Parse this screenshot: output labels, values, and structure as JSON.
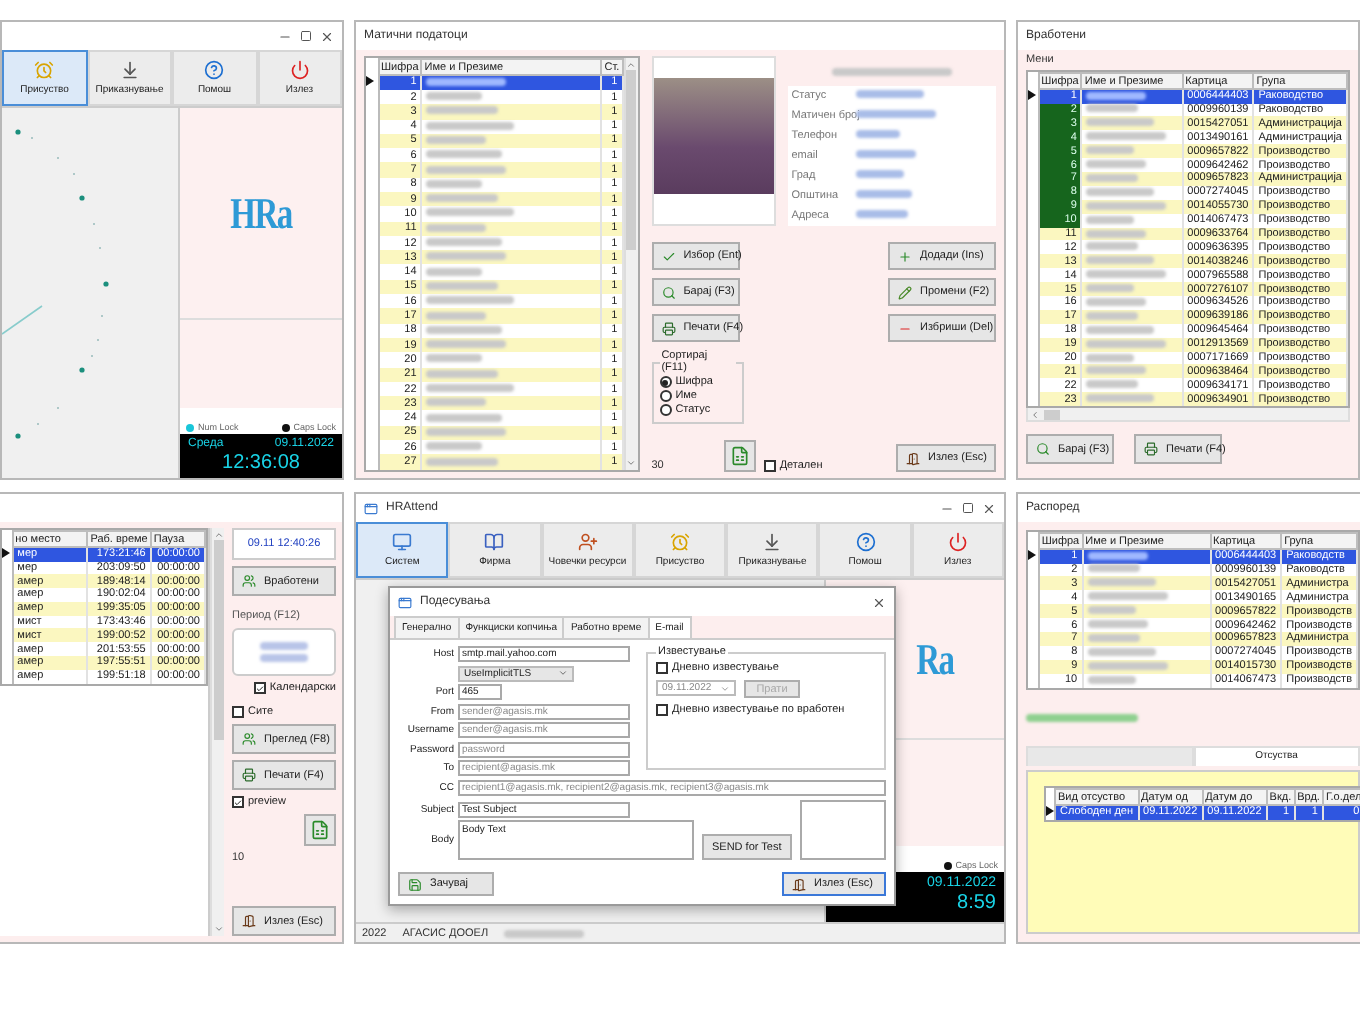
{
  "attendance_window": {
    "toolbar": [
      {
        "label": "Присуство",
        "selected": true
      },
      {
        "label": "Приказнување",
        "selected": false
      },
      {
        "label": "Помош",
        "selected": false
      },
      {
        "label": "Излез",
        "selected": false
      }
    ],
    "logo": "HRa",
    "indicators": [
      {
        "label": "Num Lock",
        "on": true
      },
      {
        "label": "Caps Lock",
        "on": false
      }
    ],
    "day": "Среда",
    "date": "09.11.2022",
    "time": "12:36:08"
  },
  "master_data": {
    "title": "Матични податоци",
    "table": {
      "columns": [
        {
          "label": "Шифра"
        },
        {
          "label": "Ст."
        }
      ],
      "name_column": "Име и Презиме",
      "rows": [
        {
          "cells": [
            "1",
            "1"
          ],
          "selected": true
        },
        {
          "cells": [
            "2",
            "1"
          ],
          "selected": false
        },
        {
          "cells": [
            "3",
            "1"
          ],
          "selected": false
        },
        {
          "cells": [
            "4",
            "1"
          ],
          "selected": false
        },
        {
          "cells": [
            "5",
            "1"
          ],
          "selected": false
        },
        {
          "cells": [
            "6",
            "1"
          ],
          "selected": false
        },
        {
          "cells": [
            "7",
            "1"
          ],
          "selected": false
        },
        {
          "cells": [
            "8",
            "1"
          ],
          "selected": false
        },
        {
          "cells": [
            "9",
            "1"
          ],
          "selected": false
        },
        {
          "cells": [
            "10",
            "1"
          ],
          "selected": false
        },
        {
          "cells": [
            "11",
            "1"
          ],
          "selected": false
        },
        {
          "cells": [
            "12",
            "1"
          ],
          "selected": false
        },
        {
          "cells": [
            "13",
            "1"
          ],
          "selected": false
        },
        {
          "cells": [
            "14",
            "1"
          ],
          "selected": false
        },
        {
          "cells": [
            "15",
            "1"
          ],
          "selected": false
        },
        {
          "cells": [
            "16",
            "1"
          ],
          "selected": false
        },
        {
          "cells": [
            "17",
            "1"
          ],
          "selected": false
        },
        {
          "cells": [
            "18",
            "1"
          ],
          "selected": false
        },
        {
          "cells": [
            "19",
            "1"
          ],
          "selected": false
        },
        {
          "cells": [
            "20",
            "1"
          ],
          "selected": false
        },
        {
          "cells": [
            "21",
            "1"
          ],
          "selected": false
        },
        {
          "cells": [
            "22",
            "1"
          ],
          "selected": false
        },
        {
          "cells": [
            "23",
            "1"
          ],
          "selected": false
        },
        {
          "cells": [
            "24",
            "1"
          ],
          "selected": false
        },
        {
          "cells": [
            "25",
            "1"
          ],
          "selected": false
        },
        {
          "cells": [
            "26",
            "1"
          ],
          "selected": false
        },
        {
          "cells": [
            "27",
            "1"
          ],
          "selected": false
        }
      ]
    },
    "fields": [
      "Статус",
      "Матичен број",
      "Телефон",
      "email",
      "Град",
      "Општина",
      "Адреса"
    ],
    "buttons_left": [
      "Избор (Ent)",
      "Барај (F3)",
      "Печати (F4)"
    ],
    "buttons_right": [
      "Додади (Ins)",
      "Промени (F2)",
      "Избриши (Del)"
    ],
    "sort": {
      "title": "Сортирај (F11)",
      "options": [
        {
          "label": "Шифра",
          "selected": true
        },
        {
          "label": "Име",
          "selected": false
        },
        {
          "label": "Статус",
          "selected": false
        }
      ]
    },
    "count": "30",
    "detail_checkbox": {
      "label": "Детален",
      "checked": false
    },
    "exit_button": "Излез (Esc)"
  },
  "employees": {
    "title": "Вработени",
    "menu_label": "Мени",
    "table": {
      "columns": [
        {
          "label": "Шифра"
        },
        {
          "label": "Картица"
        },
        {
          "label": "Група"
        }
      ],
      "name_column": "Име и Презиме",
      "rows": [
        {
          "cells": [
            "1",
            "0006444403",
            "Раководство"
          ],
          "selected": true,
          "marked": true
        },
        {
          "cells": [
            "2",
            "0009960139",
            "Раководство"
          ],
          "selected": false,
          "marked": true
        },
        {
          "cells": [
            "3",
            "0015427051",
            "Администрација"
          ],
          "selected": false,
          "marked": true
        },
        {
          "cells": [
            "4",
            "0013490161",
            "Администрација"
          ],
          "selected": false,
          "marked": true
        },
        {
          "cells": [
            "5",
            "0009657822",
            "Производство"
          ],
          "selected": false,
          "marked": true
        },
        {
          "cells": [
            "6",
            "0009642462",
            "Производство"
          ],
          "selected": false,
          "marked": true
        },
        {
          "cells": [
            "7",
            "0009657823",
            "Администрација"
          ],
          "selected": false,
          "marked": true
        },
        {
          "cells": [
            "8",
            "0007274045",
            "Производство"
          ],
          "selected": false,
          "marked": true
        },
        {
          "cells": [
            "9",
            "0014055730",
            "Производство"
          ],
          "selected": false,
          "marked": true
        },
        {
          "cells": [
            "10",
            "0014067473",
            "Производство"
          ],
          "selected": false,
          "marked": true
        },
        {
          "cells": [
            "11",
            "0009633764",
            "Производство"
          ],
          "selected": false,
          "marked": false
        },
        {
          "cells": [
            "12",
            "0009636395",
            "Производство"
          ],
          "selected": false,
          "marked": false
        },
        {
          "cells": [
            "13",
            "0014038246",
            "Производство"
          ],
          "selected": false,
          "marked": false
        },
        {
          "cells": [
            "14",
            "0007965588",
            "Производство"
          ],
          "selected": false,
          "marked": false
        },
        {
          "cells": [
            "15",
            "0007276107",
            "Производство"
          ],
          "selected": false,
          "marked": false
        },
        {
          "cells": [
            "16",
            "0009634526",
            "Производство"
          ],
          "selected": false,
          "marked": false
        },
        {
          "cells": [
            "17",
            "0009639186",
            "Производство"
          ],
          "selected": false,
          "marked": false
        },
        {
          "cells": [
            "18",
            "0009645464",
            "Производство"
          ],
          "selected": false,
          "marked": false
        },
        {
          "cells": [
            "19",
            "0012913569",
            "Производство"
          ],
          "selected": false,
          "marked": false
        },
        {
          "cells": [
            "20",
            "0007171669",
            "Производство"
          ],
          "selected": false,
          "marked": false
        },
        {
          "cells": [
            "21",
            "0009638464",
            "Производство"
          ],
          "selected": false,
          "marked": false
        },
        {
          "cells": [
            "22",
            "0009634171",
            "Производство"
          ],
          "selected": false,
          "marked": false
        },
        {
          "cells": [
            "23",
            "0009634901",
            "Производство"
          ],
          "selected": false,
          "marked": false
        }
      ]
    },
    "buttons": [
      "Барај (F3)",
      "Печати (F4)"
    ]
  },
  "work_hours": {
    "table": {
      "columns": [
        {
          "label": "но место"
        },
        {
          "label": "Раб. време"
        },
        {
          "label": "Пауза"
        }
      ],
      "rows": [
        {
          "cells": [
            "мер",
            "173:21:46",
            "00:00:00"
          ],
          "selected": true
        },
        {
          "cells": [
            "мер",
            "203:09:50",
            "00:00:00"
          ],
          "selected": false
        },
        {
          "cells": [
            "амер",
            "189:48:14",
            "00:00:00"
          ],
          "selected": false
        },
        {
          "cells": [
            "амер",
            "190:02:04",
            "00:00:00"
          ],
          "selected": false
        },
        {
          "cells": [
            "амер",
            "199:35:05",
            "00:00:00"
          ],
          "selected": false
        },
        {
          "cells": [
            "мист",
            "173:43:46",
            "00:00:00"
          ],
          "selected": false
        },
        {
          "cells": [
            "мист",
            "199:00:52",
            "00:00:00"
          ],
          "selected": false
        },
        {
          "cells": [
            "амер",
            "201:53:55",
            "00:00:00"
          ],
          "selected": false
        },
        {
          "cells": [
            "амер",
            "197:55:51",
            "00:00:00"
          ],
          "selected": false
        },
        {
          "cells": [
            "амер",
            "199:51:18",
            "00:00:00"
          ],
          "selected": false
        }
      ]
    },
    "clock": "09.11   12:40:26",
    "employees_button": "Вработени",
    "period_label": "Период (F12)",
    "calendar_checkbox": {
      "label": "Календарски",
      "checked": true
    },
    "all_checkbox": {
      "label": "Сите",
      "checked": false
    },
    "buttons": [
      "Преглед (F8)",
      "Печати (F4)"
    ],
    "preview_checkbox": {
      "label": "preview",
      "checked": true
    },
    "count": "10",
    "exit_button": "Излез (Esc)"
  },
  "settings": {
    "app_title": "HRAttend",
    "toolbar": [
      {
        "label": "Систем",
        "selected": true
      },
      {
        "label": "Фирма",
        "selected": false
      },
      {
        "label": "Човечки ресурси",
        "selected": false
      },
      {
        "label": "Присуство",
        "selected": false
      },
      {
        "label": "Приказнување",
        "selected": false
      },
      {
        "label": "Помош",
        "selected": false
      },
      {
        "label": "Излез",
        "selected": false
      }
    ],
    "logo_partial": "Ra",
    "caps_lock": {
      "label": "Caps Lock",
      "on": false
    },
    "date": "09.11.2022",
    "time_partial": "8:59",
    "status_bar": [
      "2022",
      "АГАСИС ДООЕЛ"
    ],
    "dialog": {
      "title": "Подесувања",
      "tabs": [
        {
          "label": "Генерално",
          "selected": false
        },
        {
          "label": "Функциски копчиња",
          "selected": false
        },
        {
          "label": "Работно време",
          "selected": false
        },
        {
          "label": "E-mail",
          "selected": true
        }
      ],
      "fields": [
        {
          "label": "Host",
          "kind": "text",
          "value": "smtp.mail.yahoo.com"
        },
        {
          "kind": "select",
          "value": "UseImplicitTLS"
        },
        {
          "label": "Port",
          "kind": "short",
          "value": "465"
        },
        {
          "label": "From",
          "kind": "text",
          "placeholder": "sender@agasis.mk"
        },
        {
          "label": "Username",
          "kind": "text",
          "placeholder": "sender@agasis.mk"
        },
        {
          "label": "Password",
          "kind": "text",
          "placeholder": "password"
        },
        {
          "label": "To",
          "kind": "text",
          "placeholder": "recipient@agasis.mk"
        },
        {
          "label": "CC",
          "kind": "wide",
          "placeholder": "recipient1@agasis.mk, recipient2@agasis.mk, recipient3@agasis.mk"
        },
        {
          "label": "Subject",
          "kind": "text",
          "value": "Test Subject"
        },
        {
          "label": "Body",
          "kind": "multiline",
          "value": "Body Text"
        }
      ],
      "notify": {
        "title": "Известување",
        "daily": {
          "label": "Дневно известување",
          "checked": false
        },
        "date": "09.11.2022",
        "send_button": {
          "label": "Прати",
          "disabled": true
        },
        "per_employee": {
          "label": "Дневно известување по вработен",
          "checked": false
        }
      },
      "test_button": "SEND for Test",
      "save_button": "Зачувај",
      "exit_button": "Излез (Esc)"
    }
  },
  "schedule": {
    "title": "Распоред",
    "table": {
      "columns": [
        {
          "label": "Шифра"
        },
        {
          "label": "Картица"
        },
        {
          "label": "Група"
        }
      ],
      "name_column": "Име и Презиме",
      "rows": [
        {
          "cells": [
            "1",
            "0006444403",
            "Раководств"
          ],
          "selected": true
        },
        {
          "cells": [
            "2",
            "0009960139",
            "Раководств"
          ],
          "selected": false
        },
        {
          "cells": [
            "3",
            "0015427051",
            "Администра"
          ],
          "selected": false
        },
        {
          "cells": [
            "4",
            "0013490165",
            "Администра"
          ],
          "selected": false
        },
        {
          "cells": [
            "5",
            "0009657822",
            "Производств"
          ],
          "selected": false
        },
        {
          "cells": [
            "6",
            "0009642462",
            "Производств"
          ],
          "selected": false
        },
        {
          "cells": [
            "7",
            "0009657823",
            "Администра"
          ],
          "selected": false
        },
        {
          "cells": [
            "8",
            "0007274045",
            "Производств"
          ],
          "selected": false
        },
        {
          "cells": [
            "9",
            "0014015730",
            "Производств"
          ],
          "selected": false
        },
        {
          "cells": [
            "10",
            "0014067473",
            "Производств"
          ],
          "selected": false
        }
      ]
    },
    "tabs": [
      {
        "selected": false
      },
      {
        "label": "Отсуства",
        "selected": true
      }
    ],
    "absences": {
      "columns": [
        {
          "label": "Вид отсуство"
        },
        {
          "label": "Датум од"
        },
        {
          "label": "Датум до"
        },
        {
          "label": "Вкд."
        },
        {
          "label": "Врд."
        },
        {
          "label": "Г.о.дел"
        }
      ],
      "rows": [
        {
          "cells": [
            "Слободен ден",
            "09.11.2022",
            "09.11.2022",
            "1",
            "1",
            "0"
          ],
          "selected": true
        }
      ]
    }
  }
}
